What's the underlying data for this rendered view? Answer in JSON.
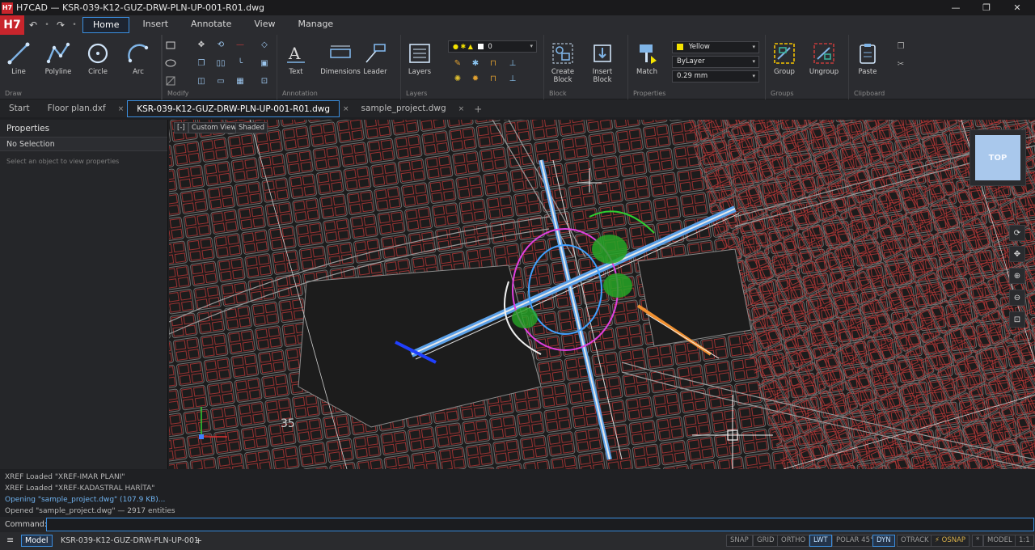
{
  "window": {
    "logo_small": "H7",
    "title": "H7CAD — KSR-039-K12-GUZ-DRW-PLN-UP-001-R01.dwg",
    "minimize": "—",
    "maximize": "❐",
    "close": "✕"
  },
  "menubar": {
    "logo": "H7",
    "undo": "↶",
    "redo": "↷",
    "more": "•",
    "items": [
      {
        "label": "Home"
      },
      {
        "label": "Insert"
      },
      {
        "label": "Annotate"
      },
      {
        "label": "View"
      },
      {
        "label": "Manage"
      }
    ]
  },
  "ribbon": {
    "groups": {
      "draw": "Draw",
      "modify": "Modify",
      "annotation": "Annotation",
      "layers": "Layers",
      "block": "Block",
      "properties": "Properties",
      "groups": "Groups",
      "clipboard": "Clipboard"
    },
    "draw": {
      "line": "Line",
      "polyline": "Polyline",
      "circle": "Circle",
      "arc": "Arc"
    },
    "annotation": {
      "text": "Text",
      "dimensions": "Dimensions",
      "leader": "Leader"
    },
    "layers": {
      "button": "Layers",
      "current_layer": "0"
    },
    "block": {
      "create": "Create Block",
      "insert": "Insert Block"
    },
    "properties": {
      "match": "Match",
      "color": "Yellow",
      "linetype": "ByLayer",
      "lineweight": "0.29 mm"
    },
    "groups_tools": {
      "group": "Group",
      "ungroup": "Ungroup"
    },
    "clipboard": {
      "paste": "Paste"
    }
  },
  "doctabs": {
    "tabs": [
      {
        "label": "Start"
      },
      {
        "label": "Floor plan.dxf"
      },
      {
        "label": "KSR-039-K12-GUZ-DRW-PLN-UP-001-R01.dwg"
      },
      {
        "label": "sample_project.dwg"
      }
    ],
    "close": "×",
    "add": "+"
  },
  "properties_panel": {
    "title": "Properties",
    "selection": "No Selection",
    "hint": "Select an object to view properties"
  },
  "viewport": {
    "minus": "[-]",
    "view": "Custom View",
    "style": "Shaded",
    "viewcube": "TOP",
    "nav": [
      "⟳",
      "✥",
      "⊕",
      "⊖",
      "⊡"
    ],
    "label_35": "35"
  },
  "command_log": [
    {
      "text": "XREF  Loaded \"XREF-IMAR PLANI\""
    },
    {
      "text": "XREF  Loaded \"XREF-KADASTRAL HARİTA\""
    },
    {
      "text": "Opening \"sample_project.dwg\" (107.9 KB)..."
    },
    {
      "text": "Opened \"sample_project.dwg\" — 2917 entities"
    }
  ],
  "command": {
    "label": "Command:"
  },
  "statusbar": {
    "menu": "≡",
    "model_tab": "Model",
    "layout_tab": "KSR-039-K12-GUZ-DRW-PLN-UP-001",
    "add": "+",
    "toggles": [
      {
        "label": "SNAP"
      },
      {
        "label": "GRID"
      },
      {
        "label": "ORTHO"
      },
      {
        "label": "LWT"
      },
      {
        "label": "POLAR 45°"
      },
      {
        "label": "DYN"
      },
      {
        "label": "OTRACK"
      },
      {
        "label": "⚡ OSNAP"
      },
      {
        "label": "*"
      },
      {
        "label": "MODEL"
      },
      {
        "label": "1:1"
      }
    ]
  },
  "colors": {
    "accent": "#3b8fe0",
    "brand": "#c8252c",
    "yellow_swatch": "#f4e300",
    "lines_red": "#c23b3b"
  }
}
